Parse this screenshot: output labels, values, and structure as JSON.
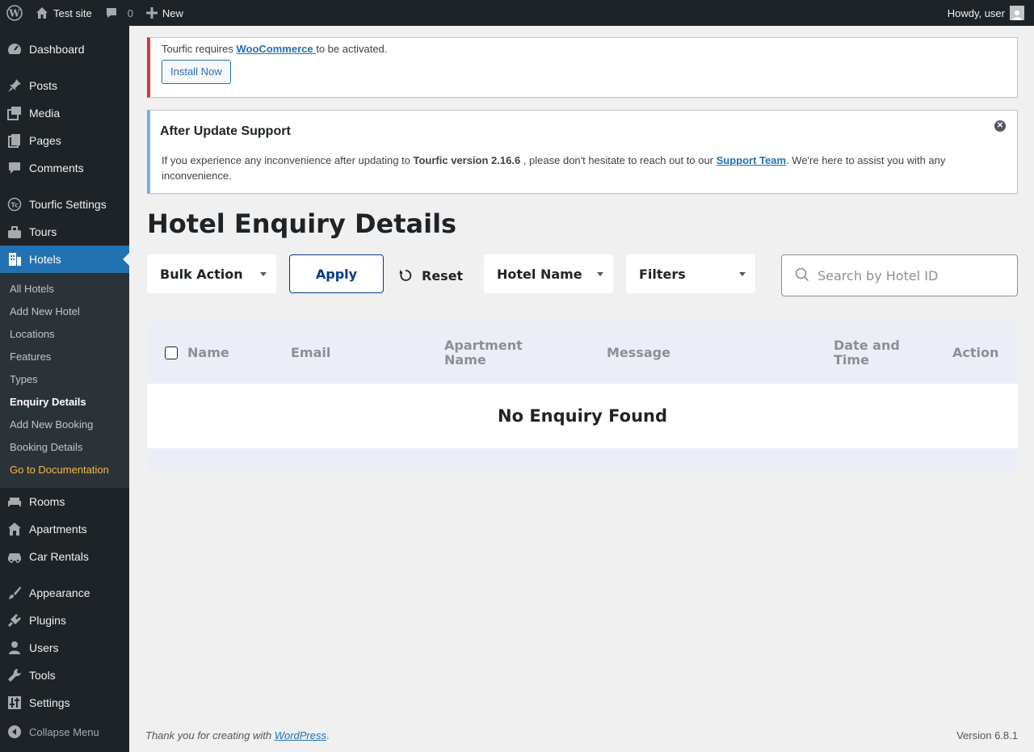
{
  "admin_bar": {
    "site_name": "Test site",
    "comments_count": "0",
    "new_label": "New",
    "greeting": "Howdy, user"
  },
  "sidebar": {
    "items": [
      {
        "label": "Dashboard",
        "icon": "dashboard-icon"
      },
      {
        "label": "Posts",
        "icon": "pin-icon"
      },
      {
        "label": "Media",
        "icon": "media-icon"
      },
      {
        "label": "Pages",
        "icon": "pages-icon"
      },
      {
        "label": "Comments",
        "icon": "comment-icon"
      },
      {
        "label": "Tourfic Settings",
        "icon": "tourfic-icon"
      },
      {
        "label": "Tours",
        "icon": "tours-icon"
      },
      {
        "label": "Hotels",
        "icon": "hotel-icon"
      },
      {
        "label": "Rooms",
        "icon": "bed-icon"
      },
      {
        "label": "Apartments",
        "icon": "home-icon"
      },
      {
        "label": "Car Rentals",
        "icon": "car-icon"
      },
      {
        "label": "Appearance",
        "icon": "brush-icon"
      },
      {
        "label": "Plugins",
        "icon": "plug-icon"
      },
      {
        "label": "Users",
        "icon": "user-icon"
      },
      {
        "label": "Tools",
        "icon": "wrench-icon"
      },
      {
        "label": "Settings",
        "icon": "sliders-icon"
      }
    ],
    "submenu": [
      "All Hotels",
      "Add New Hotel",
      "Locations",
      "Features",
      "Types",
      "Enquiry Details",
      "Add New Booking",
      "Booking Details",
      "Go to Documentation"
    ],
    "collapse_label": "Collapse Menu"
  },
  "notice_error": {
    "text_before": "Tourfic requires ",
    "link": "WooCommerce ",
    "text_after": "to be activated.",
    "button": "Install Now"
  },
  "notice_info": {
    "title": "After Update Support",
    "text_1": "If you experience any inconvenience after updating to ",
    "version": "Tourfic version 2.16.6",
    "text_2": " , please don't hesitate to reach out to our ",
    "link": "Support Team",
    "text_3": ". We're here to assist you with any inconvenience."
  },
  "page": {
    "title": "Hotel Enquiry Details"
  },
  "toolbar": {
    "bulk_action": "Bulk Action",
    "apply": "Apply",
    "reset": "Reset",
    "hotel_name": "Hotel Name",
    "filters": "Filters",
    "search_placeholder": "Search by Hotel ID"
  },
  "table": {
    "columns": [
      "Name",
      "Email",
      "Apartment Name",
      "Message",
      "Date and Time",
      "Action"
    ],
    "empty_message": "No Enquiry Found"
  },
  "footer": {
    "text": "Thank you for creating with ",
    "link": "WordPress",
    "suffix": ".",
    "version": "Version 6.8.1"
  }
}
